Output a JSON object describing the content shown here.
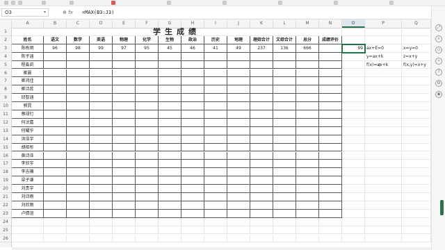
{
  "formula_bar": {
    "name_box": "O3",
    "fx_label": "fx",
    "formula": "=MAX(B3:J3)"
  },
  "columns": [
    "A",
    "B",
    "C",
    "D",
    "E",
    "F",
    "G",
    "H",
    "I",
    "J",
    "K",
    "L",
    "M",
    "N",
    "O",
    "P",
    "Q"
  ],
  "selected_column": "O",
  "rows": [
    "1",
    "2",
    "3",
    "4",
    "5",
    "6",
    "7",
    "8",
    "9",
    "10",
    "11",
    "12",
    "13",
    "14",
    "15",
    "16",
    "17",
    "18",
    "19",
    "20",
    "21",
    "22",
    "23",
    "24",
    "25",
    "26"
  ],
  "sheet": {
    "title": "学生成绩",
    "headers": [
      "姓名",
      "语文",
      "数学",
      "英语",
      "物理",
      "化学",
      "生物",
      "政治",
      "历史",
      "地理",
      "理综合计",
      "文综合计",
      "总分",
      "成绩评价"
    ],
    "first_row_values": [
      "陈栋炯",
      "96",
      "98",
      "99",
      "97",
      "95",
      "45",
      "46",
      "41",
      "49",
      "237",
      "136",
      "666",
      ""
    ],
    "students": [
      "陈栋炯",
      "陈子涵",
      "程淼凯",
      "崔晨",
      "崔鸿佳",
      "崔诗蕊",
      "邱智涵",
      "郭晁",
      "蔡翊钉",
      "何汶嘉",
      "何耀华",
      "洪浩宇",
      "胡栢彤",
      "黄诗泽",
      "李欣宇",
      "李吉禳",
      "梁子谦",
      "刘贵宇",
      "刘诗雨",
      "刘欣雨",
      "卢倩谊"
    ]
  },
  "side_cells": {
    "o3": "99",
    "p3": "ax+E=0",
    "q3": "x=y=0",
    "p4": "y=ax+k",
    "q4": "z=x+y",
    "p5": "f(x)=ax+k",
    "q5": "f(x,y)=x+y"
  },
  "icons": [
    "cursor-icon",
    "expand-icon",
    "search-icon",
    "help-icon",
    "settings-icon",
    "location-icon"
  ]
}
